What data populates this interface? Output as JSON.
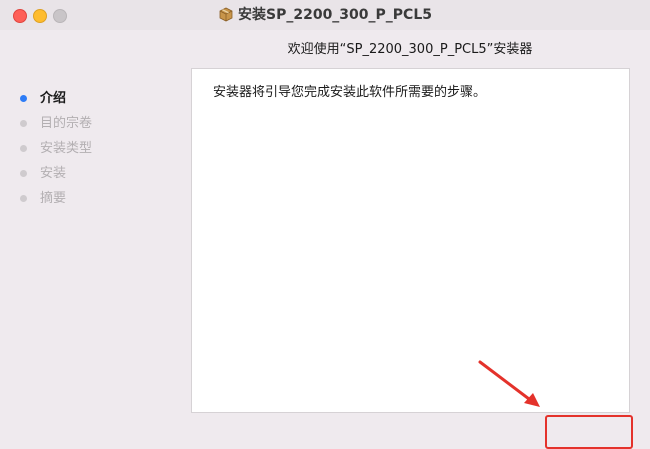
{
  "window": {
    "title": "安装SP_2200_300_P_PCL5",
    "icon": "package-icon"
  },
  "heading": "欢迎使用“SP_2200_300_P_PCL5”安装器",
  "steps": [
    {
      "label": "介绍",
      "state": "active"
    },
    {
      "label": "目的宗卷",
      "state": "inactive"
    },
    {
      "label": "安装类型",
      "state": "inactive"
    },
    {
      "label": "安装",
      "state": "inactive"
    },
    {
      "label": "摘要",
      "state": "inactive"
    }
  ],
  "content": {
    "text": "安装器将引导您完成安装此软件所需要的步骤。"
  },
  "colors": {
    "accent": "#2e7cf6",
    "annotation": "#e4322b"
  }
}
